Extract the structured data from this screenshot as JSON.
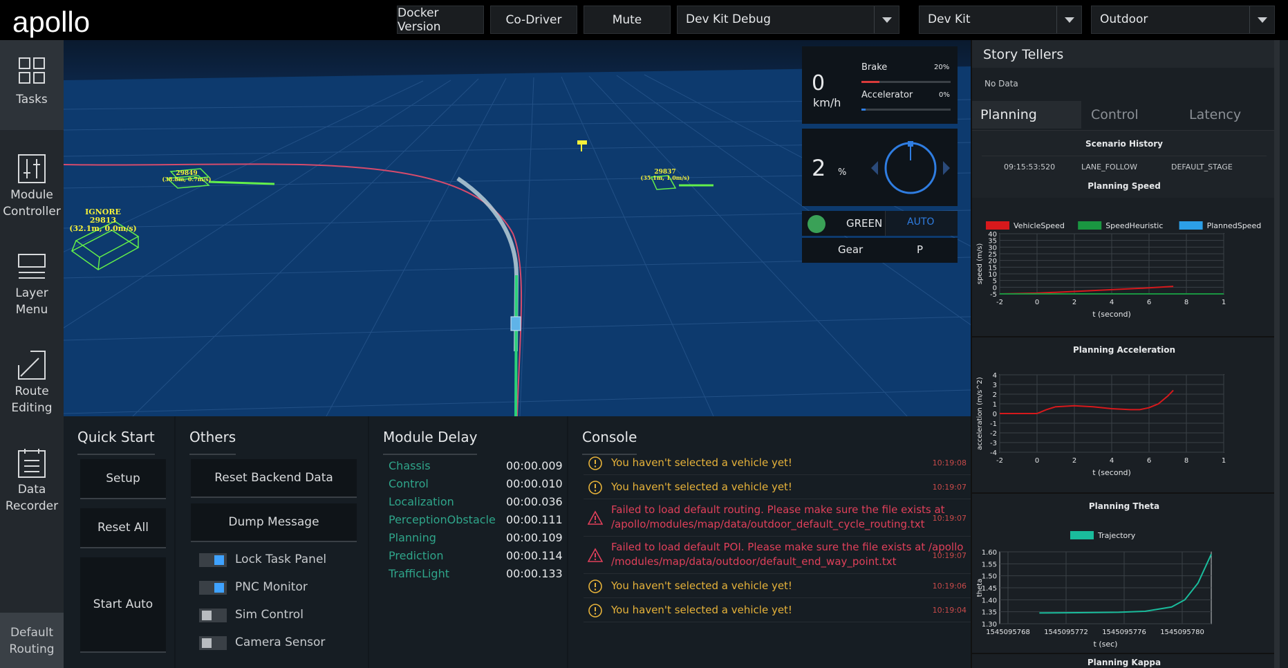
{
  "header": {
    "logo": "apollo",
    "buttons": [
      "Docker Version",
      "Co-Driver",
      "Mute"
    ],
    "mode_select": "Dev Kit Debug",
    "vehicle_select": "Dev Kit",
    "map_select": "Outdoor"
  },
  "sidenav": {
    "items": [
      {
        "label": "Tasks",
        "icon": "tasks-icon"
      },
      {
        "label": "Module Controller",
        "icon": "sliders-icon"
      },
      {
        "label": "Layer Menu",
        "icon": "layers-icon"
      },
      {
        "label": "Route Editing",
        "icon": "route-icon"
      },
      {
        "label": "Data Recorder",
        "icon": "recorder-icon"
      }
    ],
    "default_routing": "Default Routing"
  },
  "scene": {
    "obstacles": [
      {
        "line1": "IGNORE",
        "line2": "29813",
        "line3": "(32.1m, 0.0m/s)"
      },
      {
        "line1": "29849",
        "line2": "(38.8m, 0.7m/s)"
      },
      {
        "line1": "29837",
        "line2": "(35.1m, 1.0m/s)"
      }
    ]
  },
  "dashboard": {
    "speed": "0",
    "speed_unit": "km/h",
    "brake_label": "Brake",
    "brake_pct": "20%",
    "brake_level": 0.2,
    "accel_label": "Accelerator",
    "accel_pct": "0%",
    "accel_level": 0.0,
    "steering": "2",
    "steering_unit": "%",
    "signal": "GREEN",
    "mode": "AUTO",
    "gear_label": "Gear",
    "gear_value": "P",
    "colors": {
      "brake": "#d93b3b",
      "accel": "#2f7de1",
      "signal": "#3aa157",
      "auto": "#2f7de1"
    }
  },
  "quick_start": {
    "title": "Quick Start",
    "buttons": [
      "Setup",
      "Reset All",
      "Start Auto"
    ]
  },
  "others": {
    "title": "Others",
    "buttons": [
      "Reset Backend Data",
      "Dump Message"
    ],
    "toggles": [
      {
        "label": "Lock Task Panel",
        "on": true
      },
      {
        "label": "PNC Monitor",
        "on": true
      },
      {
        "label": "Sim Control",
        "on": false
      },
      {
        "label": "Camera Sensor",
        "on": false
      }
    ]
  },
  "module_delay": {
    "title": "Module Delay",
    "rows": [
      {
        "name": "Chassis",
        "value": "00:00.009"
      },
      {
        "name": "Control",
        "value": "00:00.010"
      },
      {
        "name": "Localization",
        "value": "00:00.036"
      },
      {
        "name": "PerceptionObstacle",
        "value": "00:00.111"
      },
      {
        "name": "Planning",
        "value": "00:00.109"
      },
      {
        "name": "Prediction",
        "value": "00:00.114"
      },
      {
        "name": "TrafficLight",
        "value": "00:00.133"
      }
    ]
  },
  "console": {
    "title": "Console",
    "rows": [
      {
        "level": "warn",
        "text1": "You haven't selected a vehicle yet!",
        "text2": "",
        "time": "10:19:08"
      },
      {
        "level": "warn",
        "text1": "You haven't selected a vehicle yet!",
        "text2": "",
        "time": "10:19:07"
      },
      {
        "level": "error",
        "text1": "Failed to load default routing. Please make sure the file exists at",
        "text2": "/apollo/modules/map/data/outdoor_default_cycle_routing.txt",
        "time": "10:19:07"
      },
      {
        "level": "error",
        "text1": "Failed to load default POI. Please make sure the file exists at /apollo",
        "text2": "/modules/map/data/outdoor/default_end_way_point.txt",
        "time": "10:19:07"
      },
      {
        "level": "warn",
        "text1": "You haven't selected a vehicle yet!",
        "text2": "",
        "time": "10:19:06"
      },
      {
        "level": "warn",
        "text1": "You haven't selected a vehicle yet!",
        "text2": "",
        "time": "10:19:04"
      }
    ]
  },
  "right_panel": {
    "title": "Story Tellers",
    "no_data": "No Data",
    "tabs": [
      "Planning",
      "Control",
      "Latency"
    ],
    "scenario_history": {
      "title": "Scenario History",
      "time": "09:15:53:520",
      "scenario": "LANE_FOLLOW",
      "stage": "DEFAULT_STAGE"
    },
    "section_titles": [
      "Planning Speed",
      "Planning Acceleration",
      "Planning Theta",
      "Planning Kappa"
    ]
  },
  "chart_data": [
    {
      "type": "line",
      "title": "Planning Speed",
      "xlabel": "t (second)",
      "ylabel": "speed (m/s)",
      "xlim": [
        -2,
        10
      ],
      "ylim": [
        0,
        40
      ],
      "xticks": [
        "-2",
        "0",
        "2",
        "4",
        "6",
        "8",
        "1"
      ],
      "yticks": [
        "40",
        "35",
        "30",
        "25",
        "20",
        "15",
        "10",
        "5",
        "0",
        "-5"
      ],
      "legend": "top",
      "series": [
        {
          "name": "VehicleSpeed",
          "color": "#d7191c",
          "x": [
            -2,
            0,
            2,
            4,
            6,
            7.3
          ],
          "y": [
            0,
            0.5,
            1.6,
            2.8,
            4.0,
            5.0
          ]
        },
        {
          "name": "SpeedHeuristic",
          "color": "#1a9641",
          "x": [
            -2,
            10
          ],
          "y": [
            0,
            0
          ]
        },
        {
          "name": "PlannedSpeed",
          "color": "#2c9fe8",
          "x": [],
          "y": []
        }
      ]
    },
    {
      "type": "line",
      "title": "Planning Acceleration",
      "xlabel": "t (second)",
      "ylabel": "acceleration (m/s^2)",
      "xlim": [
        -2,
        10
      ],
      "ylim": [
        -4,
        4
      ],
      "xticks": [
        "-2",
        "0",
        "2",
        "4",
        "6",
        "8",
        "1"
      ],
      "yticks": [
        "4",
        "3",
        "2",
        "1",
        "0",
        "-1",
        "-2",
        "-3",
        "-4"
      ],
      "series": [
        {
          "name": "",
          "color": "#d7191c",
          "x": [
            -2,
            0,
            0.5,
            1,
            2,
            3,
            4,
            5,
            5.5,
            6,
            6.5,
            7,
            7.3
          ],
          "y": [
            0,
            0,
            0.4,
            0.7,
            0.8,
            0.7,
            0.5,
            0.4,
            0.4,
            0.6,
            1.0,
            1.8,
            2.4
          ]
        }
      ]
    },
    {
      "type": "line",
      "title": "Planning Theta",
      "xlabel": "t (sec)",
      "ylabel": "theta",
      "xlim": [
        1545095766,
        1545095782
      ],
      "ylim": [
        1.3,
        1.6
      ],
      "xticks": [
        "1545095768",
        "1545095772",
        "1545095776",
        "1545095780"
      ],
      "yticks": [
        "1.60",
        "1.55",
        "1.50",
        "1.45",
        "1.40",
        "1.35",
        "1.30"
      ],
      "legend": "top",
      "series": [
        {
          "name": "Trajectory",
          "color": "#1abc9c",
          "x": [
            1545095769,
            1545095772,
            1545095775,
            1545095777,
            1545095779,
            1545095780,
            1545095781,
            1545095782
          ],
          "y": [
            1.345,
            1.346,
            1.348,
            1.352,
            1.37,
            1.4,
            1.47,
            1.59
          ]
        }
      ]
    }
  ]
}
